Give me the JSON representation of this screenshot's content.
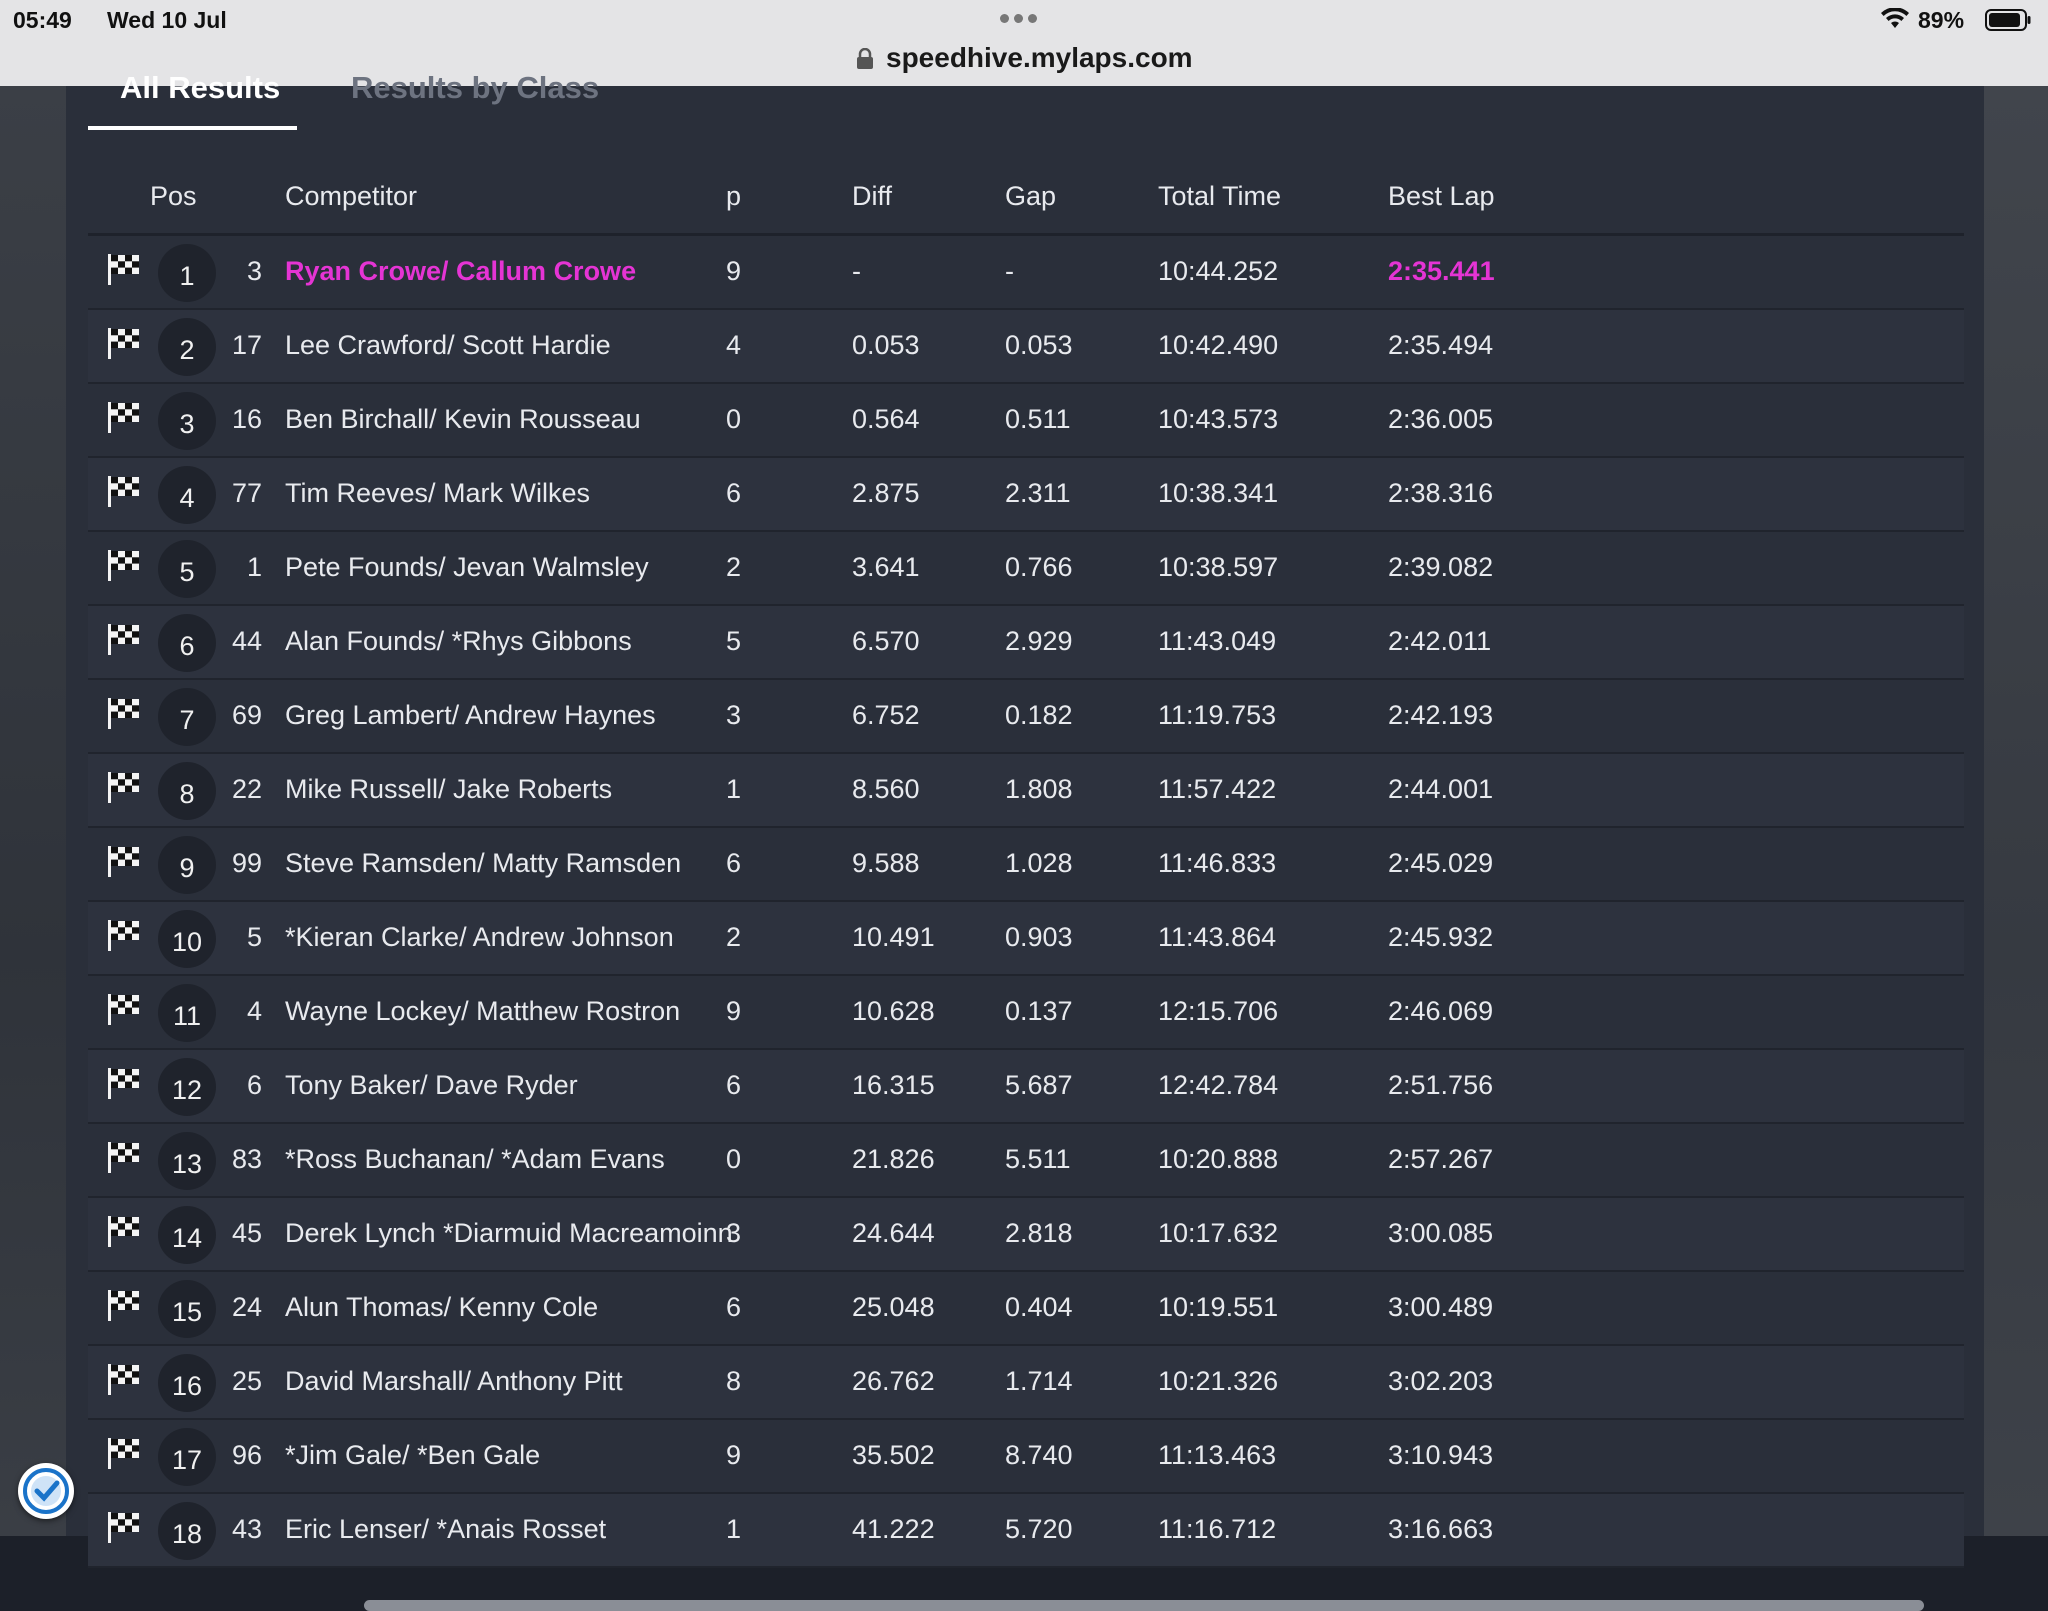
{
  "status_bar": {
    "time": "05:49",
    "date": "Wed 10 Jul",
    "battery": "89%",
    "url": "speedhive.mylaps.com"
  },
  "tabs": [
    {
      "label": "All Results",
      "active": true
    },
    {
      "label": "Results by Class",
      "active": false
    }
  ],
  "columns": {
    "pos": "Pos",
    "competitor": "Competitor",
    "p": "p",
    "diff": "Diff",
    "gap": "Gap",
    "total_time": "Total Time",
    "best_lap": "Best Lap"
  },
  "colors": {
    "highlight": "#e534d4",
    "panel": "#2a2f3a"
  },
  "rows": [
    {
      "pos": "1",
      "num": "3",
      "competitor": "Ryan Crowe/ Callum Crowe",
      "p": "9",
      "diff": "-",
      "gap": "-",
      "total": "10:44.252",
      "best": "2:35.441"
    },
    {
      "pos": "2",
      "num": "17",
      "competitor": "Lee Crawford/ Scott Hardie",
      "p": "4",
      "diff": "0.053",
      "gap": "0.053",
      "total": "10:42.490",
      "best": "2:35.494"
    },
    {
      "pos": "3",
      "num": "16",
      "competitor": "Ben Birchall/ Kevin Rousseau",
      "p": "0",
      "diff": "0.564",
      "gap": "0.511",
      "total": "10:43.573",
      "best": "2:36.005"
    },
    {
      "pos": "4",
      "num": "77",
      "competitor": "Tim Reeves/ Mark Wilkes",
      "p": "6",
      "diff": "2.875",
      "gap": "2.311",
      "total": "10:38.341",
      "best": "2:38.316"
    },
    {
      "pos": "5",
      "num": "1",
      "competitor": "Pete Founds/ Jevan Walmsley",
      "p": "2",
      "diff": "3.641",
      "gap": "0.766",
      "total": "10:38.597",
      "best": "2:39.082"
    },
    {
      "pos": "6",
      "num": "44",
      "competitor": "Alan Founds/ *Rhys Gibbons",
      "p": "5",
      "diff": "6.570",
      "gap": "2.929",
      "total": "11:43.049",
      "best": "2:42.011"
    },
    {
      "pos": "7",
      "num": "69",
      "competitor": "Greg Lambert/ Andrew Haynes",
      "p": "3",
      "diff": "6.752",
      "gap": "0.182",
      "total": "11:19.753",
      "best": "2:42.193"
    },
    {
      "pos": "8",
      "num": "22",
      "competitor": "Mike Russell/ Jake Roberts",
      "p": "1",
      "diff": "8.560",
      "gap": "1.808",
      "total": "11:57.422",
      "best": "2:44.001"
    },
    {
      "pos": "9",
      "num": "99",
      "competitor": "Steve Ramsden/ Matty Ramsden",
      "p": "6",
      "diff": "9.588",
      "gap": "1.028",
      "total": "11:46.833",
      "best": "2:45.029"
    },
    {
      "pos": "10",
      "num": "5",
      "competitor": "*Kieran Clarke/ Andrew Johnson",
      "p": "2",
      "diff": "10.491",
      "gap": "0.903",
      "total": "11:43.864",
      "best": "2:45.932"
    },
    {
      "pos": "11",
      "num": "4",
      "competitor": "Wayne Lockey/ Matthew Rostron",
      "p": "9",
      "diff": "10.628",
      "gap": "0.137",
      "total": "12:15.706",
      "best": "2:46.069"
    },
    {
      "pos": "12",
      "num": "6",
      "competitor": "Tony Baker/ Dave Ryder",
      "p": "6",
      "diff": "16.315",
      "gap": "5.687",
      "total": "12:42.784",
      "best": "2:51.756"
    },
    {
      "pos": "13",
      "num": "83",
      "competitor": "*Ross Buchanan/ *Adam Evans",
      "p": "0",
      "diff": "21.826",
      "gap": "5.511",
      "total": "10:20.888",
      "best": "2:57.267"
    },
    {
      "pos": "14",
      "num": "45",
      "competitor": "Derek Lynch *Diarmuid Macreamoinn",
      "p": "3",
      "diff": "24.644",
      "gap": "2.818",
      "total": "10:17.632",
      "best": "3:00.085"
    },
    {
      "pos": "15",
      "num": "24",
      "competitor": "Alun Thomas/ Kenny Cole",
      "p": "6",
      "diff": "25.048",
      "gap": "0.404",
      "total": "10:19.551",
      "best": "3:00.489"
    },
    {
      "pos": "16",
      "num": "25",
      "competitor": "David Marshall/ Anthony Pitt",
      "p": "8",
      "diff": "26.762",
      "gap": "1.714",
      "total": "10:21.326",
      "best": "3:02.203"
    },
    {
      "pos": "17",
      "num": "96",
      "competitor": "*Jim Gale/ *Ben Gale",
      "p": "9",
      "diff": "35.502",
      "gap": "8.740",
      "total": "11:13.463",
      "best": "3:10.943"
    },
    {
      "pos": "18",
      "num": "43",
      "competitor": "Eric Lenser/ *Anais Rosset",
      "p": "1",
      "diff": "41.222",
      "gap": "5.720",
      "total": "11:16.712",
      "best": "3:16.663"
    }
  ]
}
